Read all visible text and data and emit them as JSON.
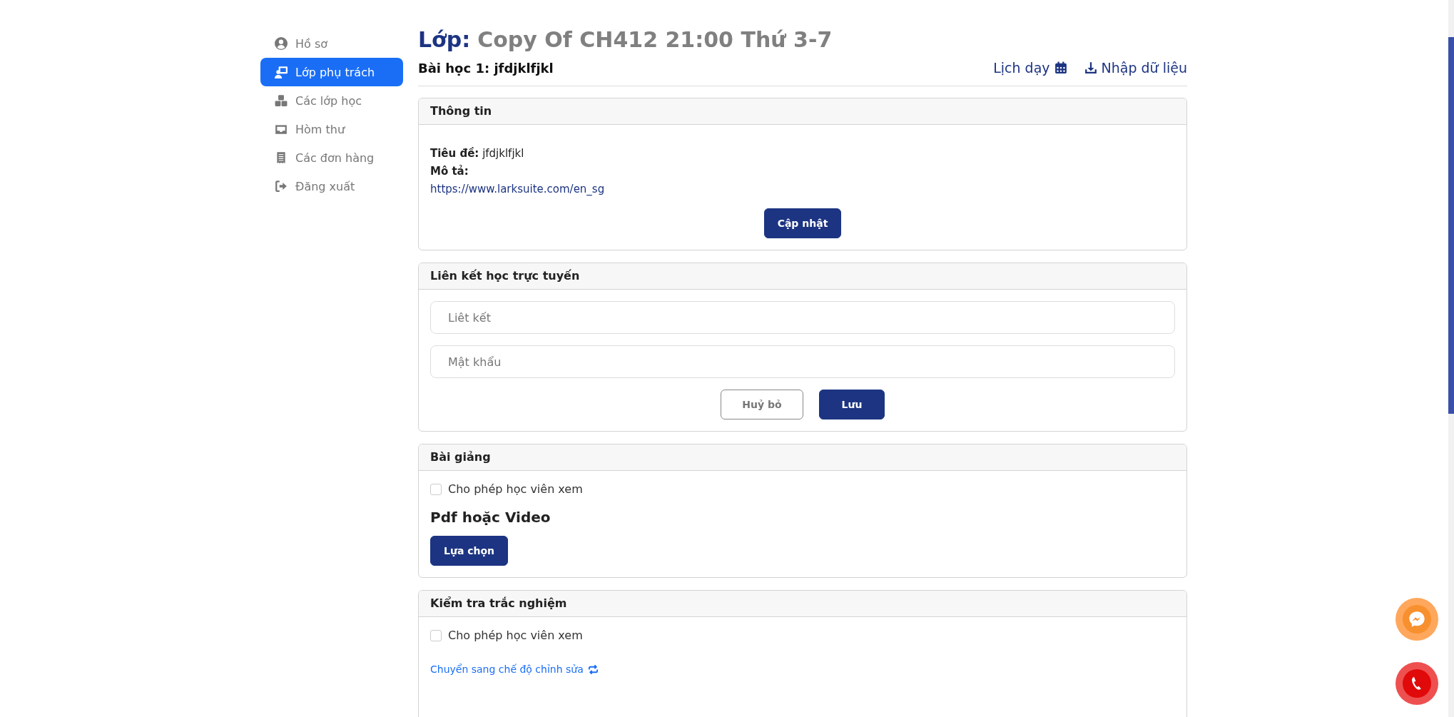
{
  "sidebar": {
    "items": [
      {
        "label": "Hồ sơ",
        "selected": false
      },
      {
        "label": "Lớp phụ trách",
        "selected": true
      },
      {
        "label": "Các lớp học",
        "selected": false
      },
      {
        "label": "Hòm thư",
        "selected": false
      },
      {
        "label": "Các đơn hàng",
        "selected": false
      },
      {
        "label": "Đăng xuất",
        "selected": false
      }
    ]
  },
  "header": {
    "title_label": "Lớp:",
    "title": "Copy Of CH412 21:00 Thứ 3-7",
    "lesson": "Bài học 1: jfdjklfjkl",
    "actions": [
      {
        "label": "Lịch dạy",
        "kind": "calendar"
      },
      {
        "label": "Nhập dữ liệu",
        "kind": "download"
      }
    ]
  },
  "cards": [
    {
      "kind": "info",
      "title": "Thông tin",
      "fields": [
        {
          "label": "Tiêu đề:",
          "value": "jfdjklfjkl"
        },
        {
          "label": "Mô tả:"
        }
      ],
      "link": "https://www.larksuite.com/en_sg",
      "button": "Cập nhật"
    },
    {
      "kind": "form",
      "title": "Liên kết học trực tuyến",
      "inputs": [
        {
          "placeholder": "Liêt kết"
        },
        {
          "placeholder": "Mật khẩu"
        }
      ],
      "buttons": [
        {
          "label": "Huỷ bỏ",
          "kind": "secondary"
        },
        {
          "label": "Lưu",
          "kind": "primary"
        }
      ]
    },
    {
      "kind": "lecture",
      "title": "Bài giảng",
      "checkbox": {
        "label": "Cho phép học viên xem",
        "checked": false
      },
      "subheading": "Pdf hoặc Video",
      "button": "Lựa chọn"
    },
    {
      "kind": "quiz",
      "title": "Kiểm tra trắc nghiệm",
      "checkbox": {
        "label": "Cho phép học viên xem",
        "checked": false
      },
      "link": "Chuyển sang chế độ chỉnh sửa"
    }
  ]
}
